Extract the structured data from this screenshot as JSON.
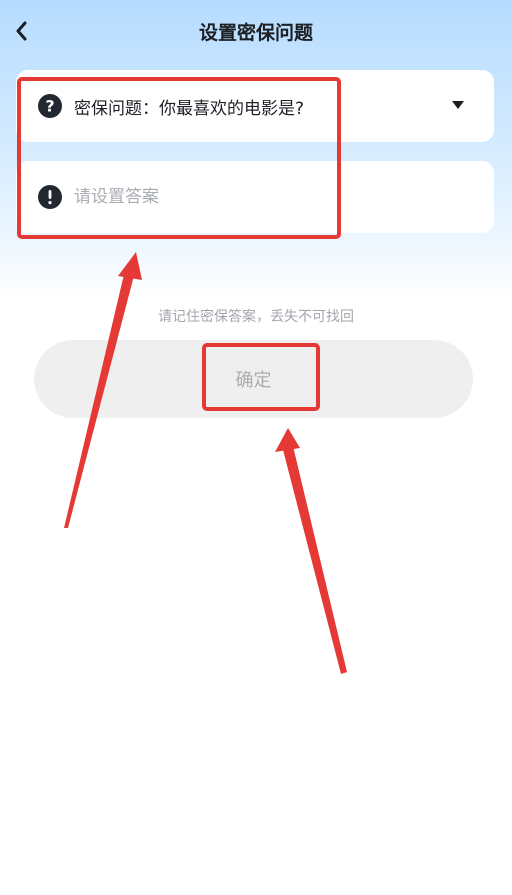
{
  "header": {
    "title": "设置密保问题",
    "back_icon": "chevron-left-icon"
  },
  "question": {
    "label": "密保问题：你最喜欢的电影是?",
    "icon": "question-circle-icon",
    "dropdown_icon": "caret-down-icon"
  },
  "answer": {
    "placeholder": "请设置答案",
    "value": "",
    "icon": "exclamation-circle-icon"
  },
  "hint": "请记住密保答案，丢失不可找回",
  "confirm_button": {
    "label": "确定"
  },
  "colors": {
    "accent_annotation": "#e53935",
    "button_bg": "#efefef",
    "header_gradient_top": "#b6dcff"
  }
}
